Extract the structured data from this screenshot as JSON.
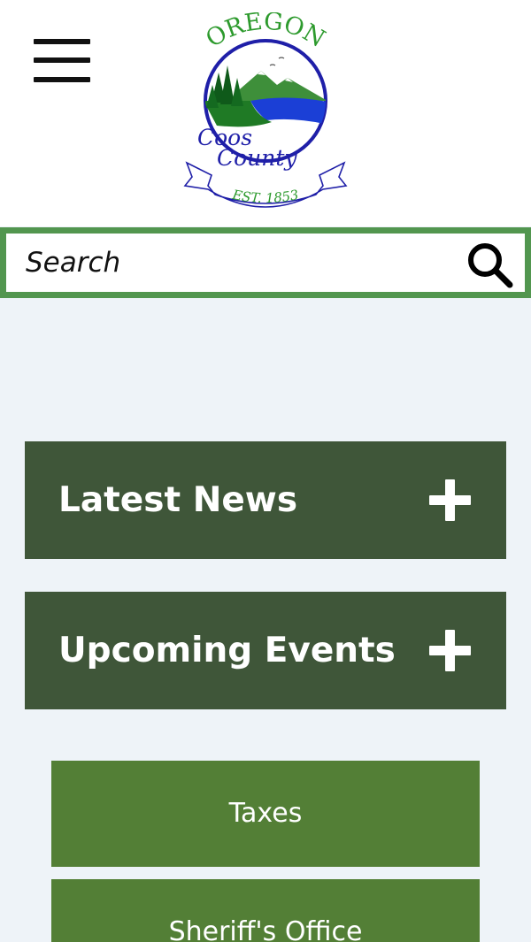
{
  "header": {
    "menu_icon": "hamburger-menu-icon",
    "logo": {
      "top_text": "OREGON",
      "name_line1": "Coos",
      "name_line2": "County",
      "est_text": "EST. 1853",
      "colors": {
        "green": "#2d9a2d",
        "blue": "#1f1fa8",
        "water": "#1b3fd6"
      }
    }
  },
  "search": {
    "placeholder": "Search",
    "icon": "search-icon",
    "border_color": "#52964f"
  },
  "accordions": [
    {
      "label": "Latest News",
      "icon": "plus-icon"
    },
    {
      "label": "Upcoming Events",
      "icon": "plus-icon"
    }
  ],
  "quick_links": [
    {
      "label": "Taxes"
    },
    {
      "label": "Sheriff's Office"
    }
  ],
  "colors": {
    "background": "#eef3f8",
    "accordion_bg": "#3f5639",
    "link_bg": "#537f36"
  }
}
